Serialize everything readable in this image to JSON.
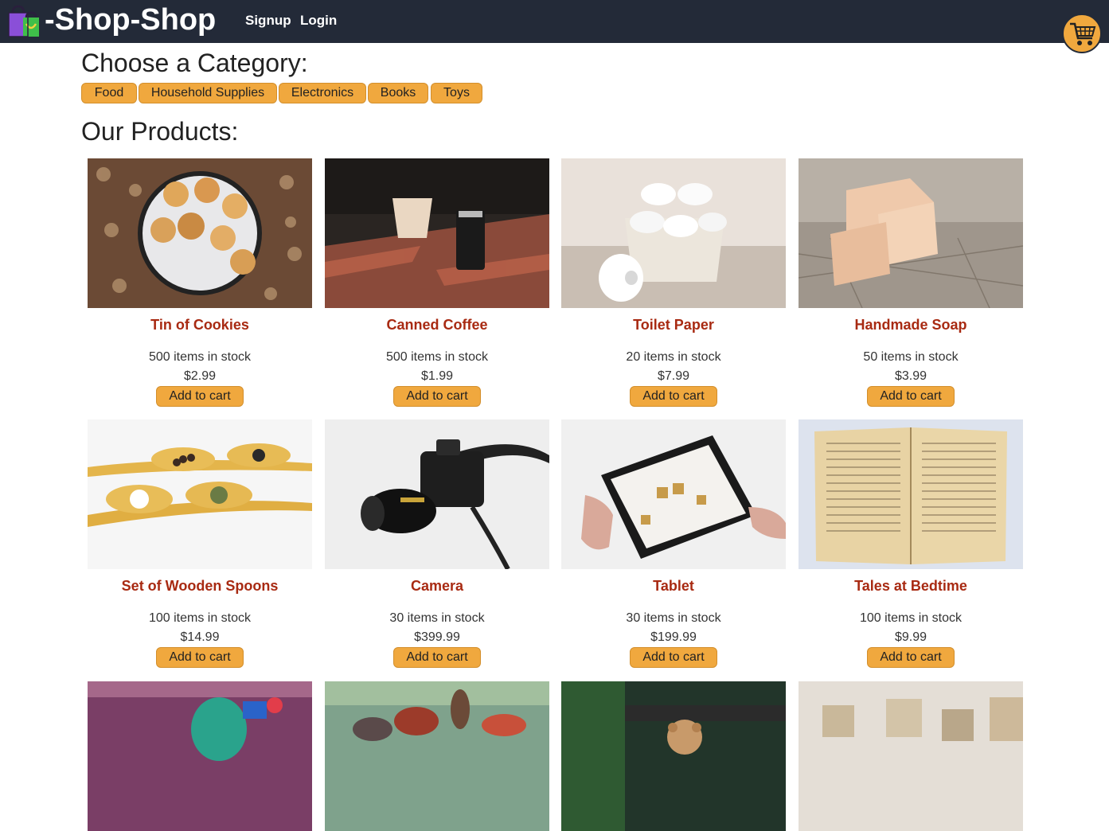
{
  "header": {
    "brand": "-Shop-Shop",
    "nav": [
      {
        "label": "Signup"
      },
      {
        "label": "Login"
      }
    ]
  },
  "categories": {
    "title": "Choose a Category:",
    "items": [
      {
        "label": "Food"
      },
      {
        "label": "Household Supplies"
      },
      {
        "label": "Electronics"
      },
      {
        "label": "Books"
      },
      {
        "label": "Toys"
      }
    ]
  },
  "products": {
    "title": "Our Products:",
    "add_label": "Add to cart",
    "items": [
      {
        "name": "Tin of Cookies",
        "stock": "500 items in stock",
        "price": "$2.99"
      },
      {
        "name": "Canned Coffee",
        "stock": "500 items in stock",
        "price": "$1.99"
      },
      {
        "name": "Toilet Paper",
        "stock": "20 items in stock",
        "price": "$7.99"
      },
      {
        "name": "Handmade Soap",
        "stock": "50 items in stock",
        "price": "$3.99"
      },
      {
        "name": "Set of Wooden Spoons",
        "stock": "100 items in stock",
        "price": "$14.99"
      },
      {
        "name": "Camera",
        "stock": "30 items in stock",
        "price": "$399.99"
      },
      {
        "name": "Tablet",
        "stock": "30 items in stock",
        "price": "$199.99"
      },
      {
        "name": "Tales at Bedtime",
        "stock": "100 items in stock",
        "price": "$9.99"
      },
      {
        "name": "",
        "stock": "",
        "price": ""
      },
      {
        "name": "",
        "stock": "",
        "price": ""
      },
      {
        "name": "",
        "stock": "",
        "price": ""
      },
      {
        "name": "",
        "stock": "",
        "price": ""
      }
    ]
  },
  "colors": {
    "header_bg": "#232a38",
    "accent": "#f0a83e",
    "product_name": "#a82a12"
  },
  "icons": {
    "logo": "shopping-bag-icon",
    "cart": "shopping-cart-icon"
  }
}
